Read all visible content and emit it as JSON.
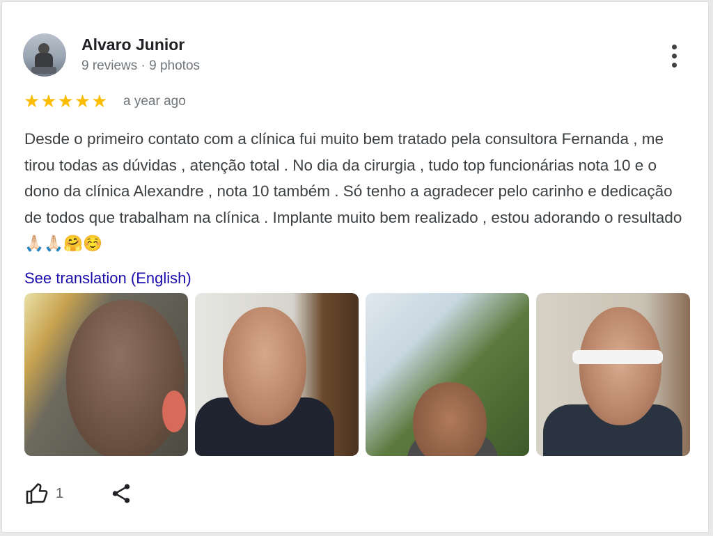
{
  "reviewer": {
    "name": "Alvaro Junior",
    "meta": "9 reviews · 9 photos"
  },
  "rating": {
    "stars": 5,
    "star_glyphs": "★★★★★",
    "time": "a year ago"
  },
  "review": {
    "text": "Desde o primeiro contato com a clínica fui muito bem tratado pela consultora Fernanda , me tirou todas as dúvidas , atenção total . No dia da cirurgia , tudo top funcionárias nota 10 e o dono da clínica Alexandre , nota 10 também . Só tenho a agradecer pelo carinho e dedicação de todos que trabalham na clínica . Implante muito bem realizado , estou adorando o resultado 🙏🏻🙏🏻🤗☺️",
    "translate_link": "See translation (English)"
  },
  "actions": {
    "like_count": "1"
  },
  "icons": {
    "more": "more-vert-icon",
    "like": "thumbs-up-icon",
    "share": "share-icon"
  },
  "colors": {
    "stars": "#fbbc04",
    "link": "#1a0dab",
    "text": "#3c4043",
    "secondary": "#70757a"
  }
}
